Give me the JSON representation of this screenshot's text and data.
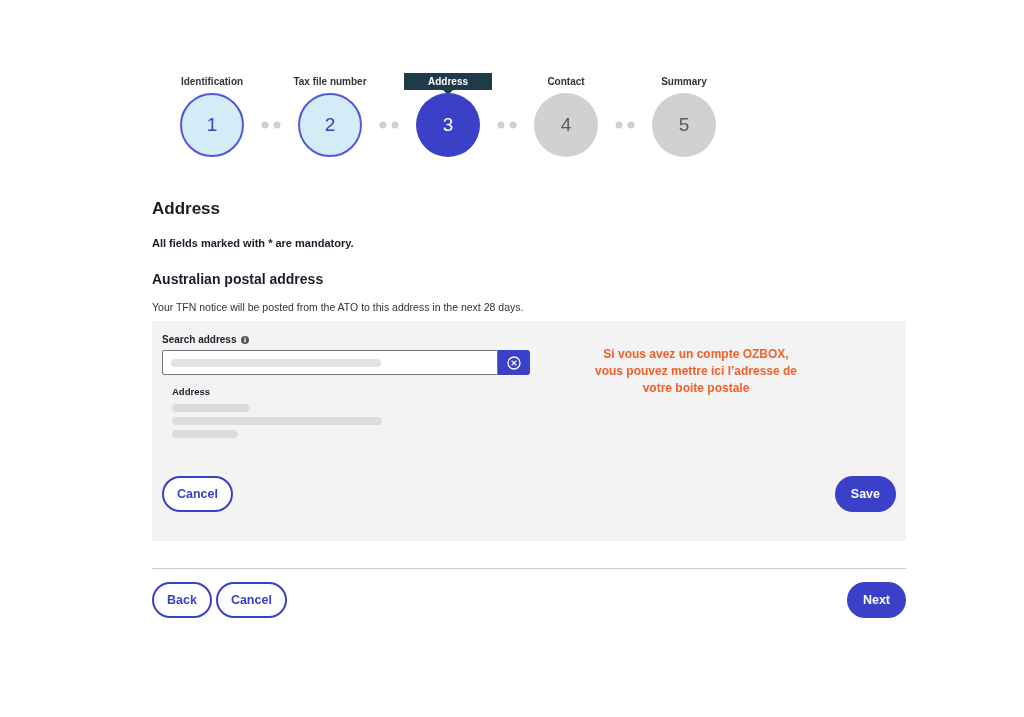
{
  "steps": [
    {
      "label": "Identification",
      "number": "1",
      "completed": true,
      "selected": false
    },
    {
      "label": "Tax file number",
      "number": "2",
      "completed": true,
      "selected": false
    },
    {
      "label": "Address",
      "number": "3",
      "completed": false,
      "selected": true
    },
    {
      "label": "Contact",
      "number": "4",
      "completed": false,
      "selected": false
    },
    {
      "label": "Summary",
      "number": "5",
      "completed": false,
      "selected": false
    }
  ],
  "heading": "Address",
  "mandatory_note": "All fields marked with * are mandatory.",
  "section_title": "Australian postal address",
  "section_note": "Your TFN notice will be posted from the ATO to this address in the next 28 days.",
  "search": {
    "label": "Search address"
  },
  "address": {
    "label": "Address"
  },
  "annotation": "Si vous avez un compte OZBOX, vous pouvez mettre ici l’adresse de votre boite postale",
  "panel_buttons": {
    "cancel": "Cancel",
    "save": "Save"
  },
  "footer_buttons": {
    "back": "Back",
    "cancel": "Cancel",
    "next": "Next"
  }
}
